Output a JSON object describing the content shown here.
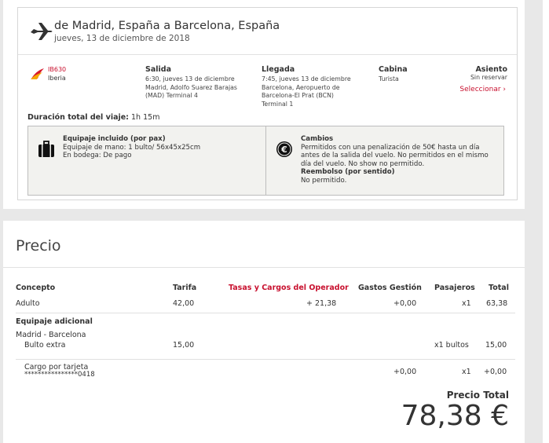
{
  "flight": {
    "route": "de Madrid, España a Barcelona, España",
    "date": "jueves, 13 de diciembre de 2018",
    "flight_number": "IB630",
    "airline": "Iberia",
    "departure": {
      "title": "Salida",
      "line1": "6:30, jueves 13 de diciembre",
      "line2": "Madrid, Adolfo Suarez Barajas",
      "line3": "(MAD) Terminal 4"
    },
    "arrival": {
      "title": "Llegada",
      "line1": "7:45, jueves 13 de diciembre",
      "line2": "Barcelona, Aeropuerto de",
      "line3": "Barcelona-El Prat (BCN)",
      "line4": "Terminal 1"
    },
    "cabin": {
      "title": "Cabina",
      "value": "Turista"
    },
    "seat": {
      "title": "Asiento",
      "value": "Sin reservar",
      "select_label": "Seleccionar ›"
    },
    "duration_label": "Duración total del viaje:",
    "duration_value": "1h 15m",
    "baggage": {
      "title": "Equipaje incluido (por pax)",
      "hand": "Equipaje de mano: 1 bulto/ 56x45x25cm",
      "hold": "En bodega: De pago"
    },
    "changes": {
      "title": "Cambios",
      "text": "Permitidos con una penalización de 50€ hasta un día antes de la salida del vuelo. No permitidos en el mismo día del vuelo. No show no permitido.",
      "refund_title": "Reembolso (por sentido)",
      "refund_text": "No permitido."
    }
  },
  "price": {
    "title": "Precio",
    "headers": {
      "concept": "Concepto",
      "fare": "Tarifa",
      "taxes": "Tasas y Cargos del Operador",
      "fees": "Gastos Gestión",
      "pax": "Pasajeros",
      "total": "Total"
    },
    "adult": {
      "concept": "Adulto",
      "fare": "42,00",
      "taxes": "+ 21,38",
      "fees": "+0,00",
      "pax": "x1",
      "total": "63,38"
    },
    "extra_title": "Equipaje adicional",
    "extra_route": "Madrid - Barcelona",
    "extra": {
      "concept": "Bulto extra",
      "fare": "15,00",
      "pax": "x1  bultos",
      "total": "15,00"
    },
    "card": {
      "concept": "Cargo por tarjeta",
      "number": "****************0418",
      "fees": "+0,00",
      "pax": "x1",
      "total": "+0,00"
    },
    "total_label": "Precio Total",
    "total_amount": "78,38 €"
  },
  "colors": {
    "accent": "#c8102e",
    "panel": "#ffffff",
    "box": "#f2f2ef"
  }
}
